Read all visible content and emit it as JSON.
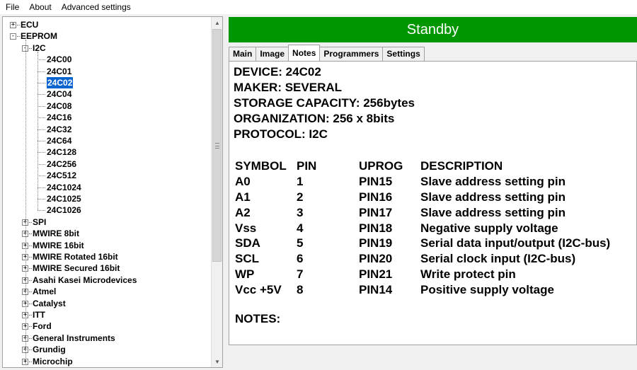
{
  "menu": [
    "File",
    "About",
    "Advanced settings"
  ],
  "tree": [
    {
      "label": "ECU",
      "level": 0,
      "expander": "+"
    },
    {
      "label": "EEPROM",
      "level": 0,
      "expander": "-"
    },
    {
      "label": "I2C",
      "level": 1,
      "expander": "-"
    },
    {
      "label": "24C00",
      "level": 2
    },
    {
      "label": "24C01",
      "level": 2
    },
    {
      "label": "24C02",
      "level": 2,
      "selected": true
    },
    {
      "label": "24C04",
      "level": 2
    },
    {
      "label": "24C08",
      "level": 2
    },
    {
      "label": "24C16",
      "level": 2
    },
    {
      "label": "24C32",
      "level": 2
    },
    {
      "label": "24C64",
      "level": 2
    },
    {
      "label": "24C128",
      "level": 2
    },
    {
      "label": "24C256",
      "level": 2
    },
    {
      "label": "24C512",
      "level": 2
    },
    {
      "label": "24C1024",
      "level": 2
    },
    {
      "label": "24C1025",
      "level": 2
    },
    {
      "label": "24C1026",
      "level": 2
    },
    {
      "label": "SPI",
      "level": 1,
      "expander": "+"
    },
    {
      "label": "MWIRE 8bit",
      "level": 1,
      "expander": "+"
    },
    {
      "label": "MWIRE 16bit",
      "level": 1,
      "expander": "+"
    },
    {
      "label": "MWIRE Rotated 16bit",
      "level": 1,
      "expander": "+"
    },
    {
      "label": "MWIRE Secured 16bit",
      "level": 1,
      "expander": "+"
    },
    {
      "label": "Asahi Kasei Microdevices",
      "level": 1,
      "expander": "+"
    },
    {
      "label": "Atmel",
      "level": 1,
      "expander": "+"
    },
    {
      "label": "Catalyst",
      "level": 1,
      "expander": "+"
    },
    {
      "label": "ITT",
      "level": 1,
      "expander": "+"
    },
    {
      "label": "Ford",
      "level": 1,
      "expander": "+"
    },
    {
      "label": "General Instruments",
      "level": 1,
      "expander": "+"
    },
    {
      "label": "Grundig",
      "level": 1,
      "expander": "+"
    },
    {
      "label": "Microchip",
      "level": 1,
      "expander": "+"
    }
  ],
  "status": {
    "text": "Standby",
    "color": "#009600"
  },
  "tabs": [
    "Main",
    "Image",
    "Notes",
    "Programmers",
    "Settings"
  ],
  "active_tab": "Notes",
  "notes": {
    "info": [
      "DEVICE: 24C02",
      "MAKER: SEVERAL",
      "STORAGE CAPACITY: 256bytes",
      "ORGANIZATION: 256 x 8bits",
      "PROTOCOL: I2C"
    ],
    "pin_header": {
      "symbol": "SYMBOL",
      "pin": "PIN",
      "uprog": "UPROG",
      "description": "DESCRIPTION"
    },
    "pins": [
      {
        "symbol": "A0",
        "pin": "1",
        "uprog": "PIN15",
        "description": "Slave address setting pin"
      },
      {
        "symbol": "A1",
        "pin": "2",
        "uprog": "PIN16",
        "description": "Slave address setting pin"
      },
      {
        "symbol": "A2",
        "pin": "3",
        "uprog": "PIN17",
        "description": "Slave address setting pin"
      },
      {
        "symbol": "Vss",
        "pin": "4",
        "uprog": "PIN18",
        "description": "Negative supply voltage"
      },
      {
        "symbol": "SDA",
        "pin": "5",
        "uprog": "PIN19",
        "description": "Serial data input/output (I2C-bus)"
      },
      {
        "symbol": "SCL",
        "pin": "6",
        "uprog": "PIN20",
        "description": "Serial clock input (I2C-bus)"
      },
      {
        "symbol": "WP",
        "pin": "7",
        "uprog": "PIN21",
        "description": "Write protect pin"
      },
      {
        "symbol": "Vcc +5V",
        "pin": "8",
        "uprog": "PIN14",
        "description": "Positive supply voltage"
      }
    ],
    "notes_label": "NOTES:"
  },
  "icons": {
    "scroll_up": "triangle-up-icon",
    "scroll_down": "triangle-down-icon",
    "scroll_grip": "grip-icon"
  }
}
